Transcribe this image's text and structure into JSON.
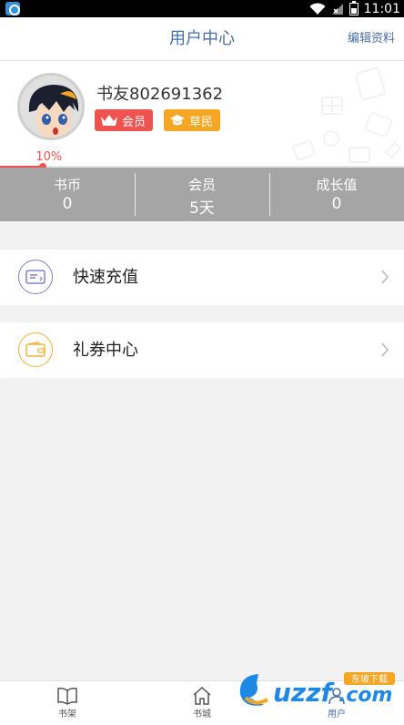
{
  "status_bar": {
    "time": "11:01"
  },
  "header": {
    "title": "用户中心",
    "edit_label": "编辑资料"
  },
  "profile": {
    "username": "书友802691362",
    "badges": [
      {
        "label": "会员",
        "icon": "crown-icon",
        "color": "#ef5350"
      },
      {
        "label": "草民",
        "icon": "graduation-cap-icon",
        "color": "#f5a623"
      }
    ],
    "progress": {
      "label": "10%",
      "fraction": 0.1
    }
  },
  "stats": [
    {
      "label": "书币",
      "value": "0"
    },
    {
      "label": "会员",
      "value": "5天"
    },
    {
      "label": "成长值",
      "value": "0"
    }
  ],
  "menu": [
    {
      "label": "快速充值",
      "icon": "card-icon"
    },
    {
      "label": "礼券中心",
      "icon": "wallet-icon"
    }
  ],
  "tabbar": {
    "tabs": [
      {
        "label": "书架",
        "icon": "book-icon"
      },
      {
        "label": "书城",
        "icon": "home-icon"
      },
      {
        "label": "用户",
        "icon": "user-icon"
      }
    ],
    "active": 2
  },
  "colors": {
    "accent": "#4a6fa5",
    "red": "#ef5350",
    "orange": "#f5a623",
    "stats_bg": "#a5a5a5"
  }
}
